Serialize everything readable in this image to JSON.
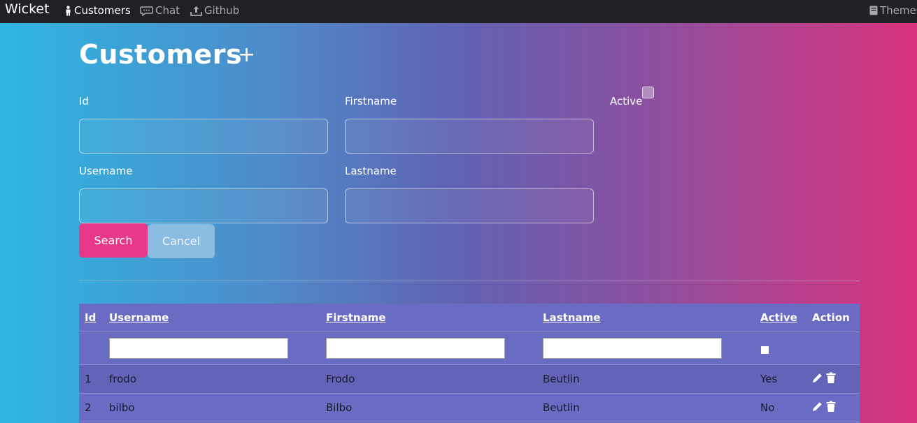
{
  "nav": {
    "brand": "Wicket",
    "links": [
      {
        "label": "Customers",
        "icon": "person-icon"
      },
      {
        "label": "Chat",
        "icon": "chat-icon"
      },
      {
        "label": "Github",
        "icon": "upload-icon"
      }
    ],
    "themes": "Themes"
  },
  "page": {
    "title": "Customers",
    "add_symbol": "+"
  },
  "form": {
    "id_label": "Id",
    "firstname_label": "Firstname",
    "active_label": "Active",
    "username_label": "Username",
    "lastname_label": "Lastname",
    "search_label": "Search",
    "cancel_label": "Cancel"
  },
  "table": {
    "headers": [
      "Id",
      "Username",
      "Firstname",
      "Lastname",
      "Active",
      "Action"
    ],
    "rows": [
      {
        "id": "1",
        "username": "frodo",
        "firstname": "Frodo",
        "lastname": "Beutlin",
        "active": "Yes"
      },
      {
        "id": "2",
        "username": "bilbo",
        "firstname": "Bilbo",
        "lastname": "Beutlin",
        "active": "No"
      }
    ]
  },
  "colors": {
    "navbar": "#1f2124",
    "search_button": "#e8388a",
    "cancel_button": "#8bbde3",
    "table_bg": "#6a6bc3"
  }
}
